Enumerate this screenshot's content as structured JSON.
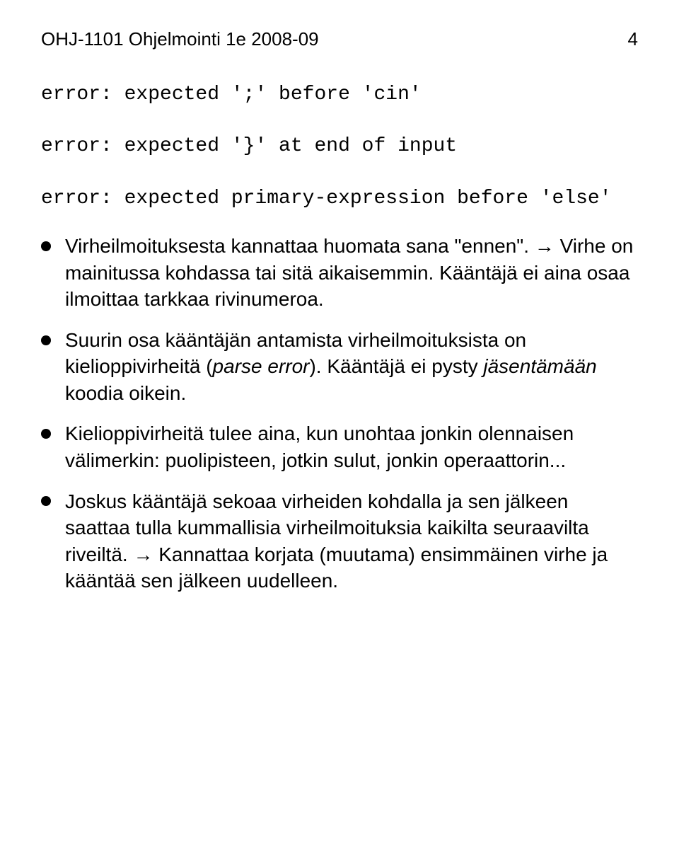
{
  "header": {
    "course": "OHJ-1101 Ohjelmointi 1e 2008-09",
    "page": "4"
  },
  "code": {
    "line1": "error: expected ';' before 'cin'",
    "line2": "error: expected '}' at end of input",
    "line3": "error: expected primary-expression before 'else'"
  },
  "bullets": {
    "b1": {
      "part1": "Virheilmoituksesta kannattaa huomata sana \"ennen\". ",
      "arrow": "→",
      "part2": " Virhe on mainitussa kohdassa tai sitä aikaisemmin. Kääntäjä ei aina osaa ilmoittaa tarkkaa rivinumeroa."
    },
    "b2": {
      "part1": "Suurin osa kääntäjän antamista virheilmoituksista on kielioppivirheitä (",
      "italic1": "parse error",
      "part2": "). Kääntäjä ei pysty ",
      "italic2": "jäsentämään",
      "part3": " koodia oikein."
    },
    "b3": {
      "text": "Kielioppivirheitä tulee aina, kun unohtaa jonkin olennaisen välimerkin: puolipisteen, jotkin sulut, jonkin operaattorin..."
    },
    "b4": {
      "part1": "Joskus kääntäjä sekoaa virheiden kohdalla ja sen jälkeen saattaa tulla kummallisia virheilmoituksia kaikilta seuraavilta riveiltä. ",
      "arrow": "→",
      "part2": " Kannattaa korjata (muutama) ensimmäinen virhe ja kääntää sen jälkeen uudelleen."
    }
  }
}
